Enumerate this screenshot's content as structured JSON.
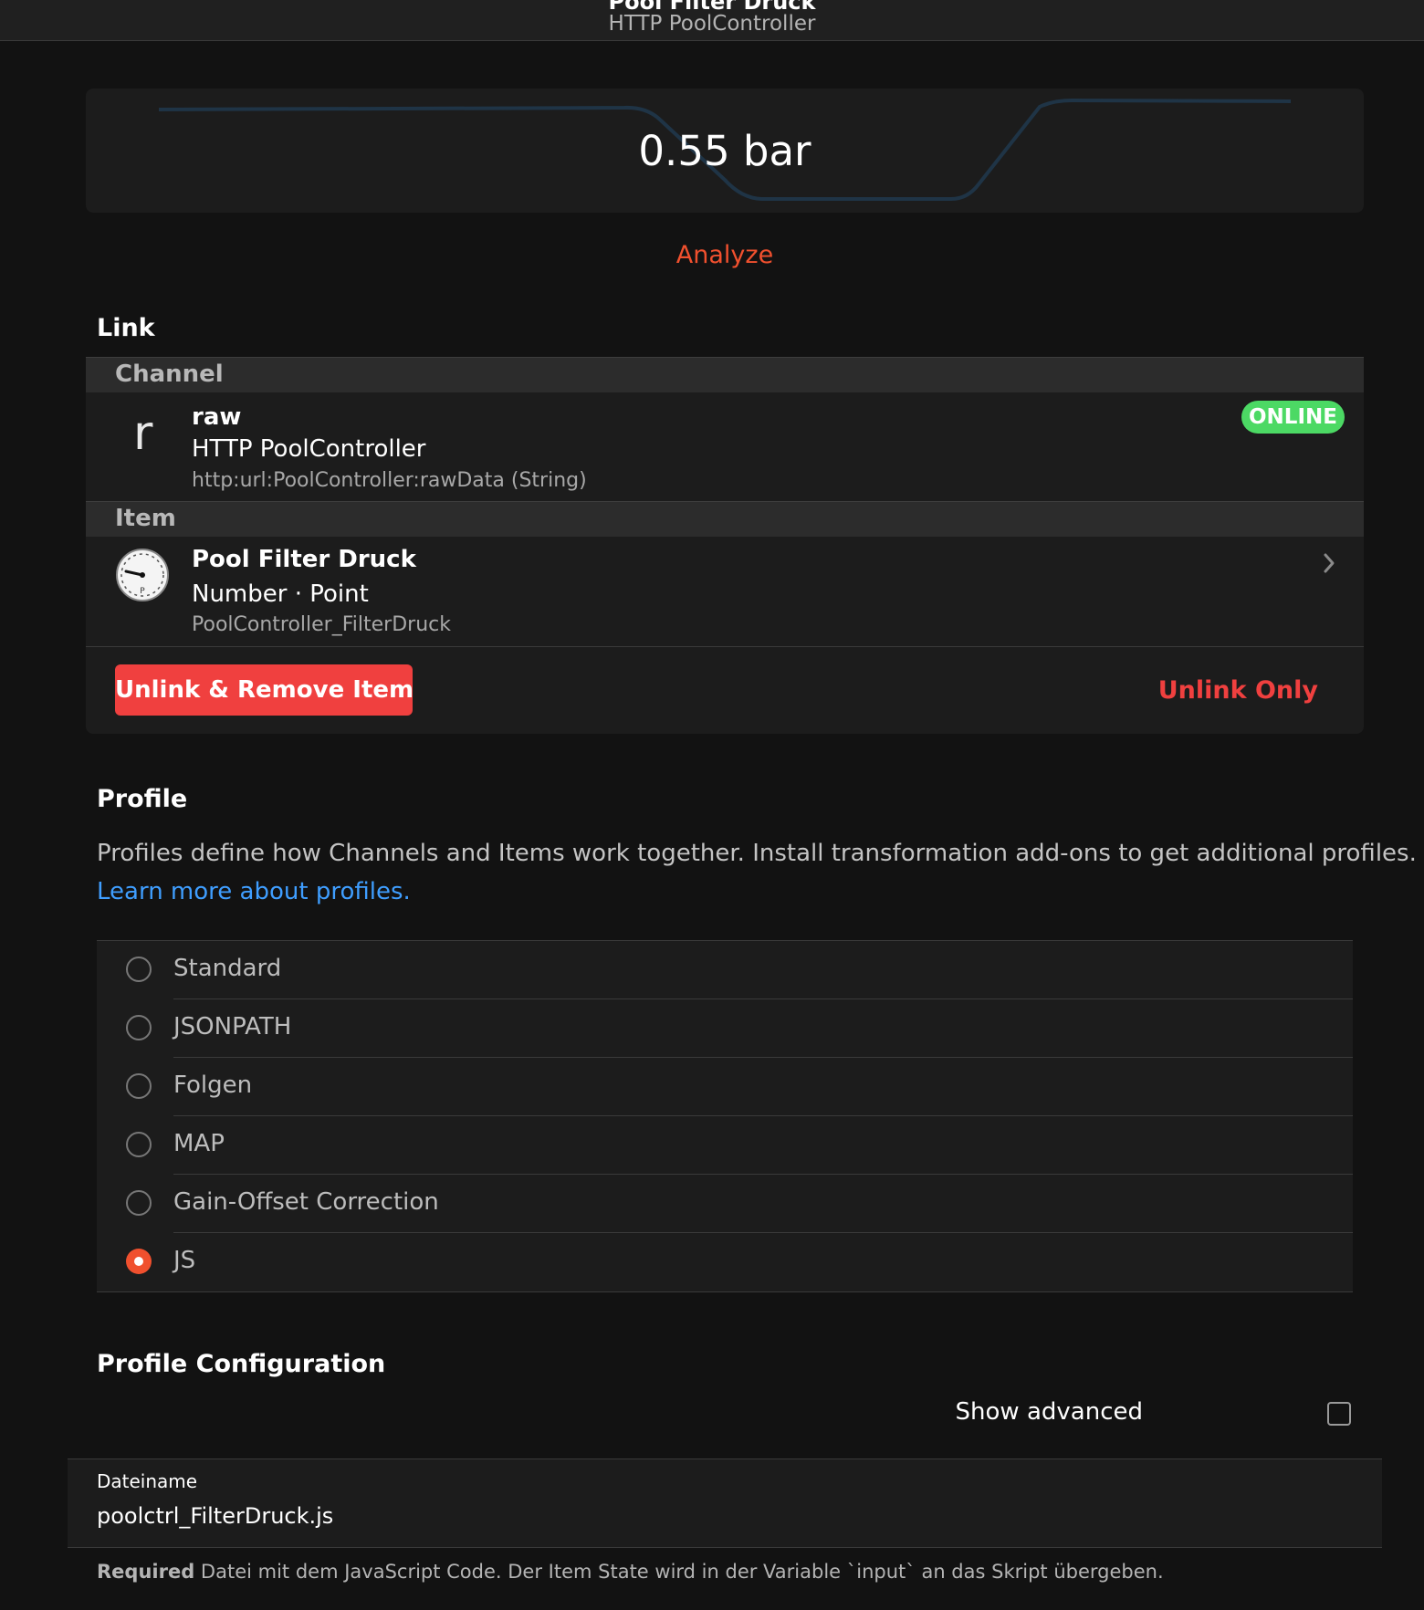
{
  "header": {
    "title": "Pool Filter Druck",
    "subtitle": "HTTP PoolController"
  },
  "trend": {
    "value": "0.55 bar",
    "line_color": "#1f3446"
  },
  "analyze_label": "Analyze",
  "link_section": {
    "title": "Link",
    "channel_header": "Channel",
    "channel": {
      "letter": "r",
      "label": "raw",
      "thing": "HTTP PoolController",
      "uid": "http:url:PoolController:rawData (String)",
      "status": "ONLINE"
    },
    "item_header": "Item",
    "item": {
      "label": "Pool Filter Druck",
      "type": "Number · Point",
      "name": "PoolController_FilterDruck"
    },
    "remove_button": "Unlink & Remove Item",
    "unlink_button": "Unlink Only"
  },
  "profile_section": {
    "title": "Profile",
    "description": "Profiles define how Channels and Items work together. Install transformation add-ons to get additional profiles.",
    "learn_more": "Learn more about profiles.",
    "options": [
      {
        "label": "Standard",
        "selected": false
      },
      {
        "label": "JSONPATH",
        "selected": false
      },
      {
        "label": "Folgen",
        "selected": false
      },
      {
        "label": "MAP",
        "selected": false
      },
      {
        "label": "Gain-Offset Correction",
        "selected": false
      },
      {
        "label": "JS",
        "selected": true
      }
    ]
  },
  "config_section": {
    "title": "Profile Configuration",
    "show_advanced": "Show advanced",
    "field_label": "Dateiname",
    "field_value": "poolctrl_FilterDruck.js",
    "hint_required": "Required",
    "hint_text": "Datei mit dem JavaScript Code. Der Item State wird in der Variable `input` an das Skript übergeben."
  },
  "colors": {
    "accent": "#f0502e",
    "danger": "#f0403f",
    "online": "#4cd964",
    "link": "#3f9eff"
  }
}
